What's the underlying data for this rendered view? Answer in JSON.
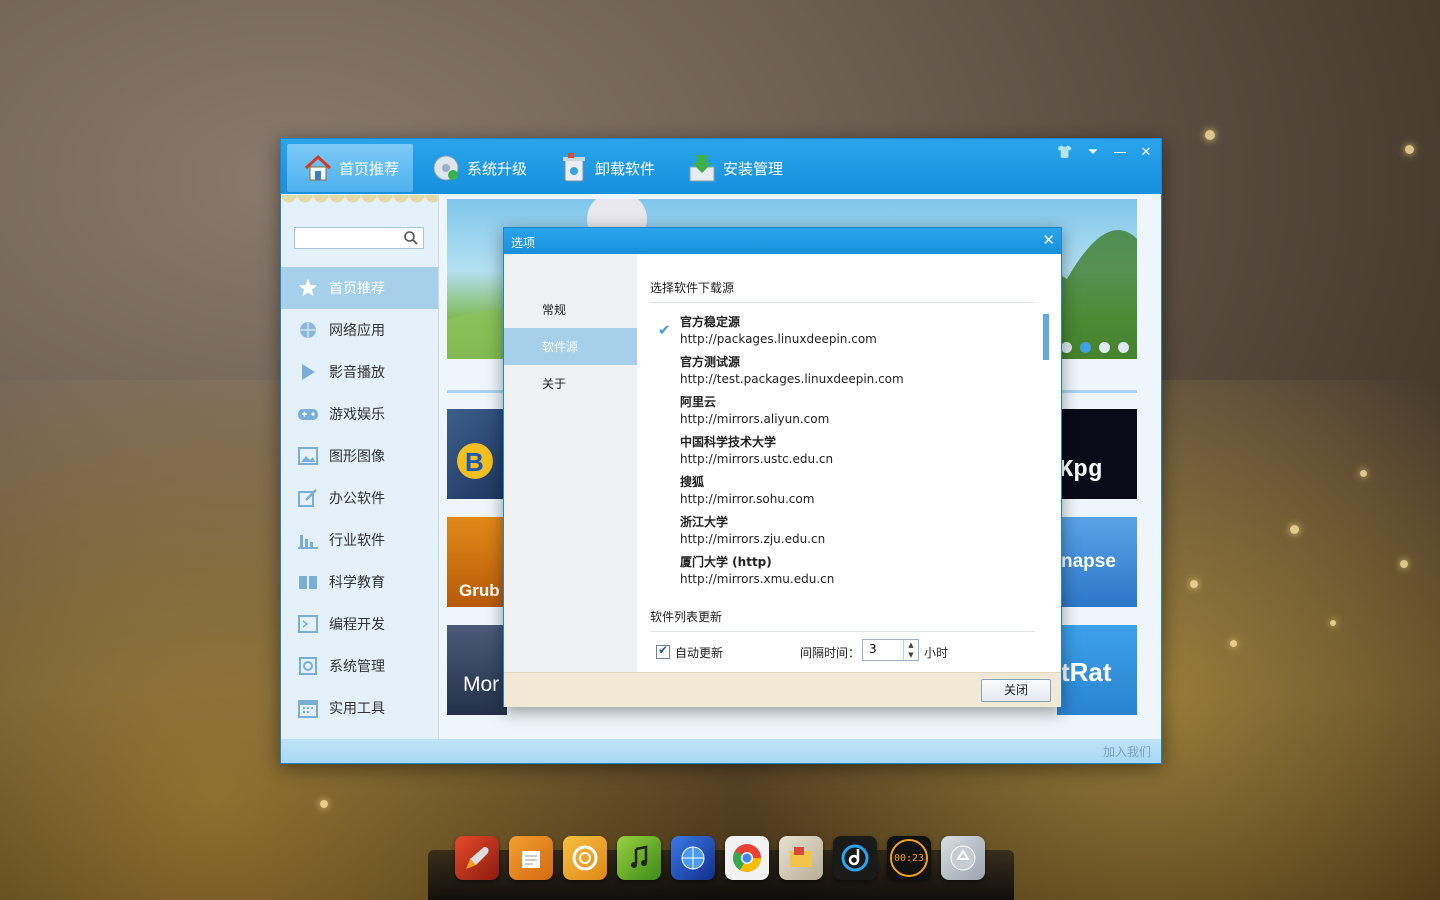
{
  "app": {
    "nav_tabs": [
      {
        "label": "首页推荐",
        "icon": "home-icon"
      },
      {
        "label": "系统升级",
        "icon": "cd-upgrade-icon"
      },
      {
        "label": "卸载软件",
        "icon": "trash-icon"
      },
      {
        "label": "安装管理",
        "icon": "download-box-icon"
      }
    ],
    "window_controls": [
      "skin-icon",
      "menu-icon",
      "minimize-icon",
      "close-icon"
    ]
  },
  "sidebar": {
    "search": {
      "value": "",
      "placeholder": ""
    },
    "categories": [
      {
        "label": "首页推荐",
        "icon": "star-icon"
      },
      {
        "label": "网络应用",
        "icon": "globe-icon"
      },
      {
        "label": "影音播放",
        "icon": "play-icon"
      },
      {
        "label": "游戏娱乐",
        "icon": "gamepad-icon"
      },
      {
        "label": "图形图像",
        "icon": "picture-icon"
      },
      {
        "label": "办公软件",
        "icon": "edit-icon"
      },
      {
        "label": "行业软件",
        "icon": "bar-chart-icon"
      },
      {
        "label": "科学教育",
        "icon": "book-icon"
      },
      {
        "label": "编程开发",
        "icon": "terminal-icon"
      },
      {
        "label": "系统管理",
        "icon": "gear-icon"
      },
      {
        "label": "实用工具",
        "icon": "calendar-icon"
      }
    ]
  },
  "content": {
    "tiles": [
      "Grub",
      "Mor",
      "Kpg",
      "napse",
      "tRat"
    ],
    "carousel_active": 2,
    "carousel_count": 4
  },
  "statusbar": {
    "join": "加入我们"
  },
  "dialog": {
    "title": "选项",
    "nav": [
      "常规",
      "软件源",
      "关于"
    ],
    "section_source": "选择软件下载源",
    "sources": [
      {
        "name": "官方稳定源",
        "url": "http://packages.linuxdeepin.com"
      },
      {
        "name": "官方测试源",
        "url": "http://test.packages.linuxdeepin.com"
      },
      {
        "name": "阿里云",
        "url": "http://mirrors.aliyun.com"
      },
      {
        "name": "中国科学技术大学",
        "url": "http://mirrors.ustc.edu.cn"
      },
      {
        "name": "搜狐",
        "url": "http://mirror.sohu.com"
      },
      {
        "name": "浙江大学",
        "url": "http://mirrors.zju.edu.cn"
      },
      {
        "name": "厦门大学 (http)",
        "url": "http://mirrors.xmu.edu.cn"
      }
    ],
    "section_update": "软件列表更新",
    "auto_update_label": "自动更新",
    "interval_label": "间隔时间：",
    "interval_value": "3",
    "interval_unit": "小时",
    "close_button": "关闭"
  },
  "dock": {
    "clock": "00:23",
    "icons": [
      "rocket-icon",
      "notepad-icon",
      "swirl-icon",
      "music-icon",
      "browser-globe-icon",
      "chrome-icon",
      "file-manager-icon",
      "deepin-music-icon",
      "clock-icon",
      "trash-dock-icon"
    ]
  }
}
